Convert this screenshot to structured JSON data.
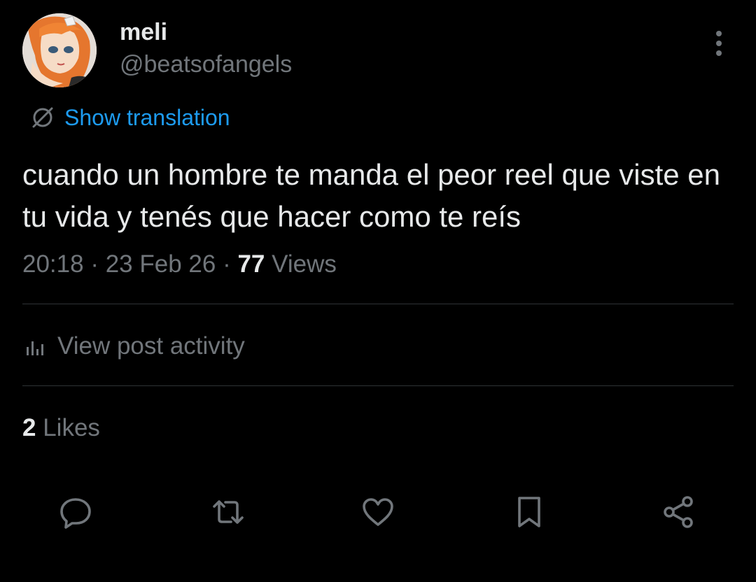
{
  "user": {
    "display_name": "meli",
    "handle": "@beatsofangels",
    "avatar": "avatar-illustration"
  },
  "translation": {
    "icon": "translate-icon",
    "label": "Show translation"
  },
  "post": {
    "text": "cuando un hombre te manda el peor reel que viste en tu vida y tenés que hacer como te reís",
    "time": "20:18",
    "date": "23 Feb 26",
    "views_count": "77",
    "views_label": "Views",
    "separator": "·"
  },
  "activity": {
    "icon": "bar-chart-icon",
    "label": "View post activity"
  },
  "likes": {
    "count": "2",
    "label": "Likes"
  },
  "actions": [
    {
      "name": "reply",
      "icon": "reply-icon"
    },
    {
      "name": "repost",
      "icon": "repost-icon"
    },
    {
      "name": "like",
      "icon": "heart-icon"
    },
    {
      "name": "bookmark",
      "icon": "bookmark-icon"
    },
    {
      "name": "share",
      "icon": "share-icon"
    }
  ],
  "colors": {
    "background": "#000000",
    "primary_text": "#e7e9ea",
    "secondary_text": "#71767b",
    "accent": "#1d9bf0",
    "divider": "#2f3336"
  }
}
